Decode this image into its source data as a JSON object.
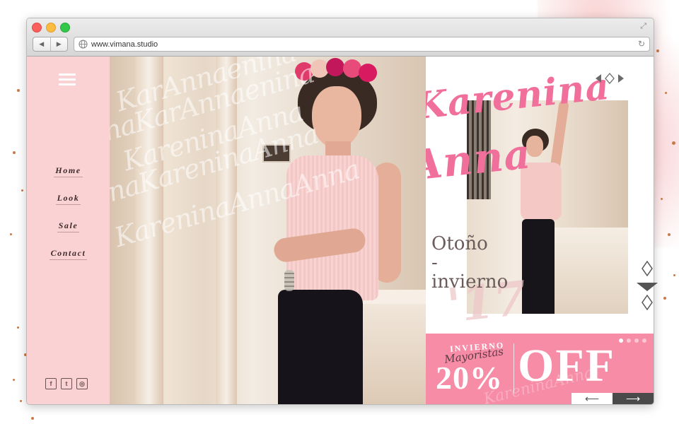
{
  "browser": {
    "url": "www.vimana.studio"
  },
  "sidebar": {
    "menu": [
      {
        "label": "Home"
      },
      {
        "label": "Look"
      },
      {
        "label": "Sale"
      },
      {
        "label": "Contact"
      }
    ],
    "social": [
      {
        "icon": "facebook-icon",
        "glyph": "f"
      },
      {
        "icon": "twitter-icon",
        "glyph": "t"
      },
      {
        "icon": "instagram-icon",
        "glyph": "◎"
      }
    ]
  },
  "hero": {
    "script_lines": [
      "KarAnnaenina",
      "naKarAnnaenina",
      "KareninaAnna",
      "naKareninaAnna",
      "KareninaAnnaAnna"
    ]
  },
  "panel": {
    "brand_line1": "Karenina",
    "brand_line2": "Anna",
    "season_line1": "Otoño",
    "season_line2": "-",
    "season_line3": "invierno",
    "season_year": "'17"
  },
  "promo": {
    "label": "INVIERNO",
    "script": "Mayoristas",
    "percent": "20%",
    "off": "OFF",
    "watermark": "KareninaAnna",
    "slide_count": 4,
    "active_slide": 0,
    "prev": "⟵",
    "next": "⟶"
  },
  "colors": {
    "accent_pink": "#f78ca6",
    "sidebar_pink": "#fbd2d3",
    "brand_script": "#f0709b"
  }
}
